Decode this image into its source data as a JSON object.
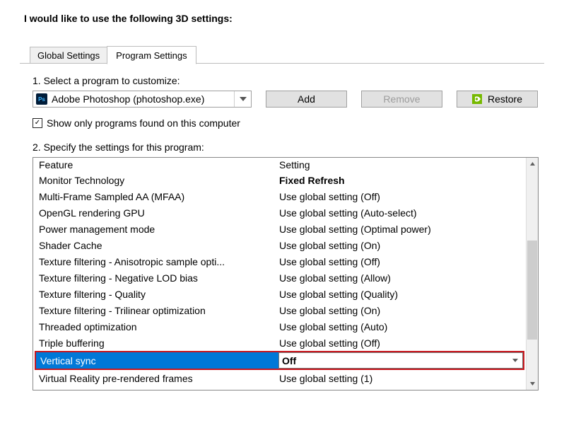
{
  "header": "I would like to use the following 3D settings:",
  "tabs": {
    "global": "Global Settings",
    "program": "Program Settings"
  },
  "step1_label": "1. Select a program to customize:",
  "program_select": {
    "icon": "Ps",
    "text": "Adobe Photoshop (photoshop.exe)"
  },
  "buttons": {
    "add": "Add",
    "remove": "Remove",
    "restore": "Restore"
  },
  "show_only_checkbox": {
    "checked": true,
    "label": "Show only programs found on this computer"
  },
  "step2_label": "2. Specify the settings for this program:",
  "grid_headers": {
    "feature": "Feature",
    "setting": "Setting"
  },
  "rows": [
    {
      "feature": "Monitor Technology",
      "setting": "Fixed Refresh",
      "bold": true
    },
    {
      "feature": "Multi-Frame Sampled AA (MFAA)",
      "setting": "Use global setting (Off)"
    },
    {
      "feature": "OpenGL rendering GPU",
      "setting": "Use global setting (Auto-select)"
    },
    {
      "feature": "Power management mode",
      "setting": "Use global setting (Optimal power)"
    },
    {
      "feature": "Shader Cache",
      "setting": "Use global setting (On)"
    },
    {
      "feature": "Texture filtering - Anisotropic sample opti...",
      "setting": "Use global setting (Off)"
    },
    {
      "feature": "Texture filtering - Negative LOD bias",
      "setting": "Use global setting (Allow)"
    },
    {
      "feature": "Texture filtering - Quality",
      "setting": "Use global setting (Quality)"
    },
    {
      "feature": "Texture filtering - Trilinear optimization",
      "setting": "Use global setting (On)"
    },
    {
      "feature": "Threaded optimization",
      "setting": "Use global setting (Auto)"
    },
    {
      "feature": "Triple buffering",
      "setting": "Use global setting (Off)"
    }
  ],
  "highlight": {
    "feature": "Vertical sync",
    "setting": "Off"
  },
  "rows_after": [
    {
      "feature": "Virtual Reality pre-rendered frames",
      "setting": "Use global setting (1)"
    }
  ]
}
